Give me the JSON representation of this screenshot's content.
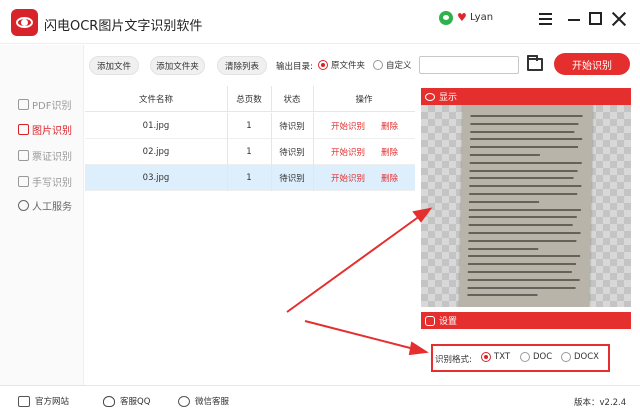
{
  "app": {
    "title": "闪电OCR图片文字识别软件",
    "user": "Lyan"
  },
  "sidebar": {
    "items": [
      {
        "label": "PDF识别"
      },
      {
        "label": "图片识别"
      },
      {
        "label": "票证识别"
      },
      {
        "label": "手写识别"
      },
      {
        "label": "人工服务"
      }
    ]
  },
  "toolbar": {
    "add_file": "添加文件",
    "add_folder": "添加文件夹",
    "clear_list": "清除列表",
    "output_label": "输出目录:",
    "option_source": "原文件夹",
    "option_custom": "自定义",
    "path_value": "",
    "start": "开始识别"
  },
  "table": {
    "headers": [
      "文件名称",
      "总页数",
      "状态",
      "操作"
    ],
    "rows": [
      {
        "name": "01.jpg",
        "pages": "1",
        "status": "待识别",
        "start": "开始识别",
        "delete": "删除"
      },
      {
        "name": "02.jpg",
        "pages": "1",
        "status": "待识别",
        "start": "开始识别",
        "delete": "删除"
      },
      {
        "name": "03.jpg",
        "pages": "1",
        "status": "待识别",
        "start": "开始识别",
        "delete": "删除"
      }
    ]
  },
  "preview": {
    "title": "显示"
  },
  "settings": {
    "title": "设置",
    "format_label": "识别格式:",
    "formats": [
      "TXT",
      "DOC",
      "DOCX"
    ],
    "selected_format": "TXT"
  },
  "footer": {
    "website": "官方网站",
    "qq": "客服QQ",
    "wechat": "微信客服",
    "version": "版本：v2.2.4"
  },
  "colors": {
    "accent": "#e52e2e",
    "selected_row": "#ddeffd"
  }
}
